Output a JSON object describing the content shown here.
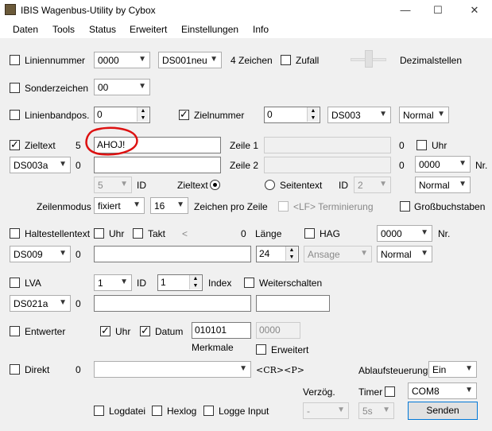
{
  "window": {
    "title": "IBIS Wagenbus-Utility by Cybox",
    "minimize": "—",
    "maximize": "☐",
    "close": "✕"
  },
  "menu": [
    "Daten",
    "Tools",
    "Status",
    "Erweitert",
    "Einstellungen",
    "Info"
  ],
  "linie": {
    "label": "Liniennummer",
    "value": "0000",
    "ds": "DS001neu",
    "zeichen": "4 Zeichen",
    "zufall": "Zufall",
    "dezimal": "Dezimalstellen"
  },
  "sonder": {
    "label": "Sonderzeichen",
    "value": "00"
  },
  "linienband": {
    "label": "Linienbandpos.",
    "value": "0"
  },
  "zielnummer": {
    "label": "Zielnummer",
    "value": "0",
    "ds": "DS003",
    "mode": "Normal"
  },
  "zieltext": {
    "label": "Zieltext",
    "count": "5",
    "value": "AHOJ!",
    "zeile1": "Zeile 1",
    "zeile1_count": "0",
    "uhr": "Uhr",
    "ds": "DS003a",
    "ds_count": "0",
    "zeile2": "Zeile 2",
    "zeile2_count": "0",
    "zeile2_dd": "0000",
    "nr": "Nr.",
    "id_dd": "5",
    "id": "ID",
    "radio_zieltext": "Zieltext",
    "radio_seitentext": "Seitentext",
    "id2": "ID",
    "id2_dd": "2",
    "mode": "Normal"
  },
  "zeilenmodus": {
    "label": "Zeilenmodus",
    "mode": "fixiert",
    "count": "16",
    "zeichen": "Zeichen pro Zeile",
    "lf": "<LF> Terminierung",
    "gross": "Großbuchstaben"
  },
  "halte": {
    "label": "Haltestellentext",
    "uhr": "Uhr",
    "takt": "Takt",
    "arrow": "<",
    "zero": "0",
    "laenge": "Länge",
    "hag": "HAG",
    "dd": "0000",
    "nr": "Nr.",
    "ds": "DS009",
    "ds_count": "0",
    "len": "24",
    "ansage": "Ansage",
    "mode": "Normal"
  },
  "lva": {
    "label": "LVA",
    "dd": "1",
    "id": "ID",
    "spin": "1",
    "index": "Index",
    "weiter": "Weiterschalten",
    "ds": "DS021a",
    "ds_count": "0"
  },
  "entwerter": {
    "label": "Entwerter",
    "uhr": "Uhr",
    "datum": "Datum",
    "value": "010101",
    "value2": "0000",
    "merkmale": "Merkmale",
    "erweitert": "Erweitert"
  },
  "direkt": {
    "label": "Direkt",
    "count": "0",
    "crp": "<CR><P>",
    "ablauf": "Ablaufsteuerung",
    "ablauf_val": "Ein"
  },
  "bottom": {
    "verzoeg": "Verzög.",
    "verzoeg_val": "-",
    "timer": "Timer",
    "timer_val": "5s",
    "com": "COM8",
    "senden": "Senden",
    "logdatei": "Logdatei",
    "hexlog": "Hexlog",
    "logge": "Logge Input"
  }
}
